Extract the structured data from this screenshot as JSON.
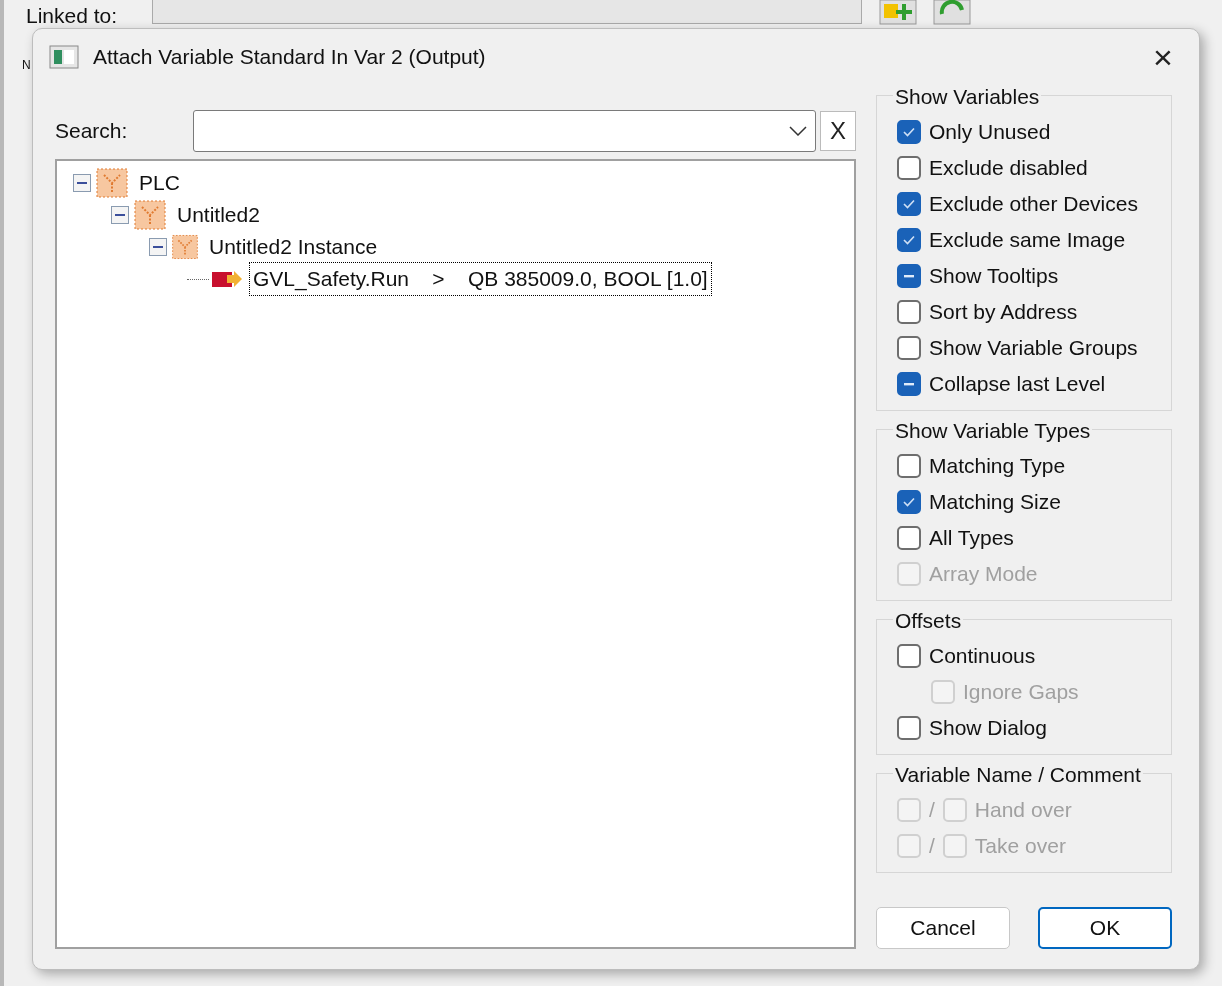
{
  "background_window": {
    "labels": [
      "Linked to:",
      "N"
    ]
  },
  "dialog": {
    "title": "Attach Variable Standard In Var 2 (Output)",
    "close": "×",
    "search": {
      "label": "Search:",
      "clear": "X"
    },
    "tree": [
      {
        "label": "PLC",
        "expanded": true,
        "kind": "folder",
        "children": [
          {
            "label": "Untitled2",
            "expanded": true,
            "kind": "folder",
            "children": [
              {
                "label": "Untitled2 Instance",
                "expanded": true,
                "kind": "instance",
                "children": [
                  {
                    "label": "GVL_Safety.Run    >    QB 385009.0, BOOL [1.0]",
                    "kind": "variable",
                    "selected": true
                  }
                ]
              }
            ]
          }
        ]
      }
    ],
    "groups": [
      {
        "title": "Show Variables",
        "items": [
          {
            "kind": "check",
            "label": "Only Unused",
            "checked": true,
            "indeterminate": false,
            "disabled": false
          },
          {
            "kind": "check",
            "label": "Exclude disabled",
            "checked": false,
            "indeterminate": false,
            "disabled": false
          },
          {
            "kind": "check",
            "label": "Exclude other Devices",
            "checked": true,
            "indeterminate": false,
            "disabled": false
          },
          {
            "kind": "check",
            "label": "Exclude same Image",
            "checked": true,
            "indeterminate": false,
            "disabled": false
          },
          {
            "kind": "check",
            "label": "Show Tooltips",
            "checked": false,
            "indeterminate": true,
            "disabled": false
          },
          {
            "kind": "check",
            "label": "Sort by Address",
            "checked": false,
            "indeterminate": false,
            "disabled": false
          },
          {
            "kind": "check",
            "label": "Show Variable Groups",
            "checked": false,
            "indeterminate": false,
            "disabled": false
          },
          {
            "kind": "check",
            "label": "Collapse last Level",
            "checked": false,
            "indeterminate": true,
            "disabled": false
          }
        ]
      },
      {
        "title": "Show Variable Types",
        "items": [
          {
            "kind": "check",
            "label": "Matching Type",
            "checked": false,
            "indeterminate": false,
            "disabled": false
          },
          {
            "kind": "check",
            "label": "Matching Size",
            "checked": true,
            "indeterminate": false,
            "disabled": false
          },
          {
            "kind": "check",
            "label": "All Types",
            "checked": false,
            "indeterminate": false,
            "disabled": false
          },
          {
            "kind": "check",
            "label": "Array Mode",
            "checked": false,
            "indeterminate": false,
            "disabled": true
          }
        ]
      },
      {
        "title": "Offsets",
        "items": [
          {
            "kind": "check",
            "label": "Continuous",
            "checked": false,
            "indeterminate": false,
            "disabled": false
          },
          {
            "kind": "subcheck",
            "label": "Ignore Gaps",
            "checked": false,
            "indeterminate": false,
            "disabled": true
          },
          {
            "kind": "check",
            "label": "Show Dialog",
            "checked": false,
            "indeterminate": false,
            "disabled": false
          }
        ]
      },
      {
        "title": "Variable Name / Comment",
        "items": [
          {
            "kind": "pair",
            "label": "Hand over",
            "separator": "/",
            "checked": false,
            "checked_2": false,
            "disabled": true
          },
          {
            "kind": "pair",
            "label": "Take over",
            "separator": "/",
            "checked": false,
            "checked_2": false,
            "disabled": true
          }
        ]
      }
    ],
    "buttons": [
      {
        "label": "Cancel",
        "default": false
      },
      {
        "label": "OK",
        "default": true
      }
    ]
  }
}
